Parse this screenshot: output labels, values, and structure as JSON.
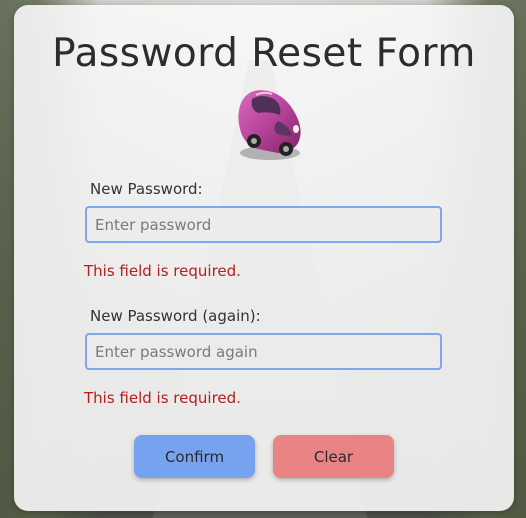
{
  "form": {
    "title": "Password Reset Form",
    "password": {
      "label": "New Password:",
      "placeholder": "Enter password",
      "value": "",
      "error": "This field is required."
    },
    "password_again": {
      "label": "New Password (again):",
      "placeholder": "Enter password again",
      "value": "",
      "error": "This field is required."
    },
    "confirm_label": "Confirm",
    "clear_label": "Clear"
  },
  "icons": {
    "logo": "car-icon"
  },
  "colors": {
    "input_border": "#7fa6f0",
    "error_text": "#b41e1e",
    "confirm_button": "#77a2f0",
    "clear_button": "#ea8384",
    "car_body": "#b8439a"
  }
}
